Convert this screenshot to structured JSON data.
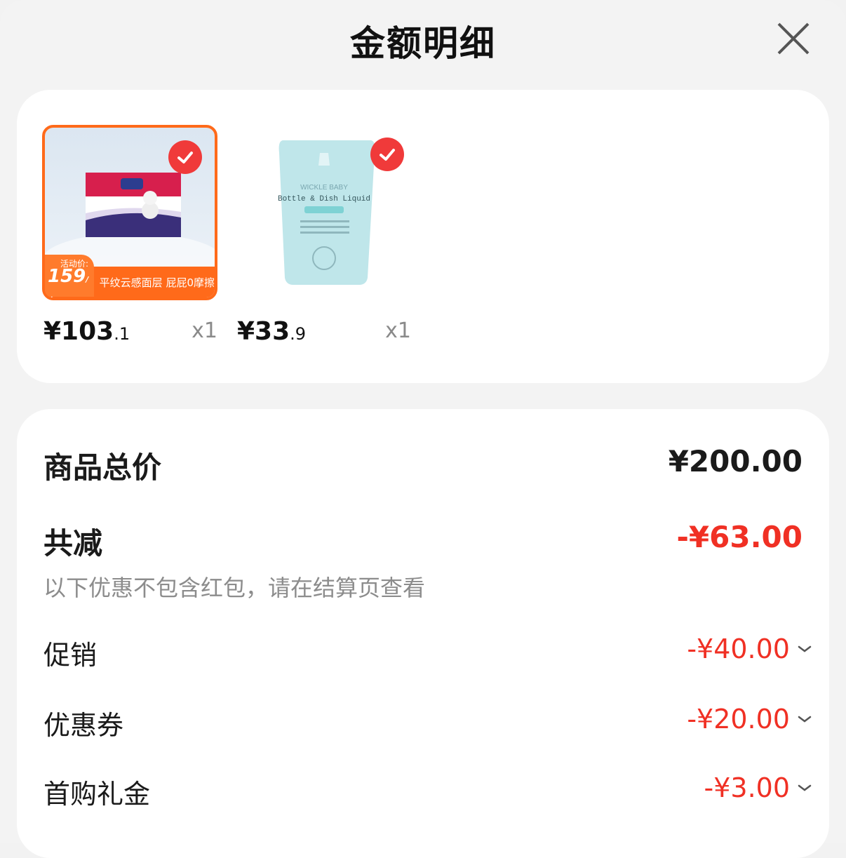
{
  "header": {
    "title": "金额明细"
  },
  "products": [
    {
      "price_int": "¥103",
      "price_dec": ".1",
      "qty": "x1",
      "selected": true,
      "promo": {
        "label": "活动价:",
        "price": "159",
        "unit": "/包",
        "slogan": "平纹云感面层 屁屁0摩擦"
      },
      "image_icon": "diaper-box-icon"
    },
    {
      "price_int": "¥33",
      "price_dec": ".9",
      "qty": "x1",
      "selected": true,
      "image_icon": "bottle-liquid-pouch-icon",
      "pouch_brand": "WICKLE BABY",
      "pouch_name": "Bottle & Dish Liquid"
    }
  ],
  "summary": {
    "total_label": "商品总价",
    "total_value": "¥200.00",
    "reduce_label": "共减",
    "reduce_value": "-¥63.00",
    "note": "以下优惠不包含红包，请在结算页查看",
    "details": [
      {
        "label": "促销",
        "value": "-¥40.00"
      },
      {
        "label": "优惠券",
        "value": "-¥20.00"
      },
      {
        "label": "首购礼金",
        "value": "-¥3.00"
      }
    ]
  },
  "colors": {
    "accent_red": "#f03024",
    "promo_orange": "#ff6a1a",
    "check_red": "#f03a3a"
  }
}
